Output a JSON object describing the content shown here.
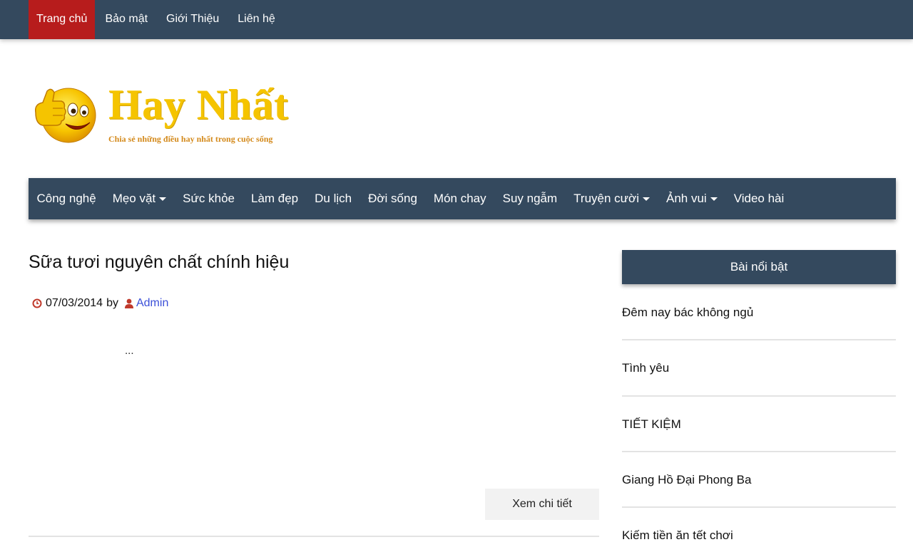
{
  "top_nav": {
    "items": [
      "Trang chủ",
      "Bảo mật",
      "Giới Thiệu",
      "Liên hệ"
    ]
  },
  "logo": {
    "title": "Hay Nhất",
    "tagline": "Chia sẻ những điều hay nhất trong cuộc sống"
  },
  "main_menu": {
    "items": [
      {
        "label": "Công nghệ"
      },
      {
        "label": "Mẹo vặt",
        "dropdown": true
      },
      {
        "label": "Sức khỏe"
      },
      {
        "label": "Làm đẹp"
      },
      {
        "label": "Du lịch"
      },
      {
        "label": "Đời sống"
      },
      {
        "label": "Món chay"
      },
      {
        "label": "Suy ngẫm"
      },
      {
        "label": "Truyện cười",
        "dropdown": true
      },
      {
        "label": "Ảnh vui",
        "dropdown": true
      },
      {
        "label": "Video hài"
      }
    ]
  },
  "post": {
    "title": "Sữa tươi nguyên chất chính hiệu",
    "date": "07/03/2014",
    "by": "by",
    "author": "Admin",
    "excerpt": "...",
    "read_more": "Xem chi tiết"
  },
  "sidebar": {
    "title": "Bài nổi bật",
    "items": [
      "Đêm nay bác không ngủ",
      "Tình yêu",
      "TIẾT KIỆM",
      "Giang Hồ Đại Phong Ba",
      "Kiếm tiền ăn tết chơi"
    ]
  },
  "colors": {
    "nav_bg": "#34495e",
    "active_tab": "#b71c1c",
    "logo_yellow": "#f5c400",
    "author_link": "#3b4fd8",
    "meta_icon": "#c0392b"
  }
}
